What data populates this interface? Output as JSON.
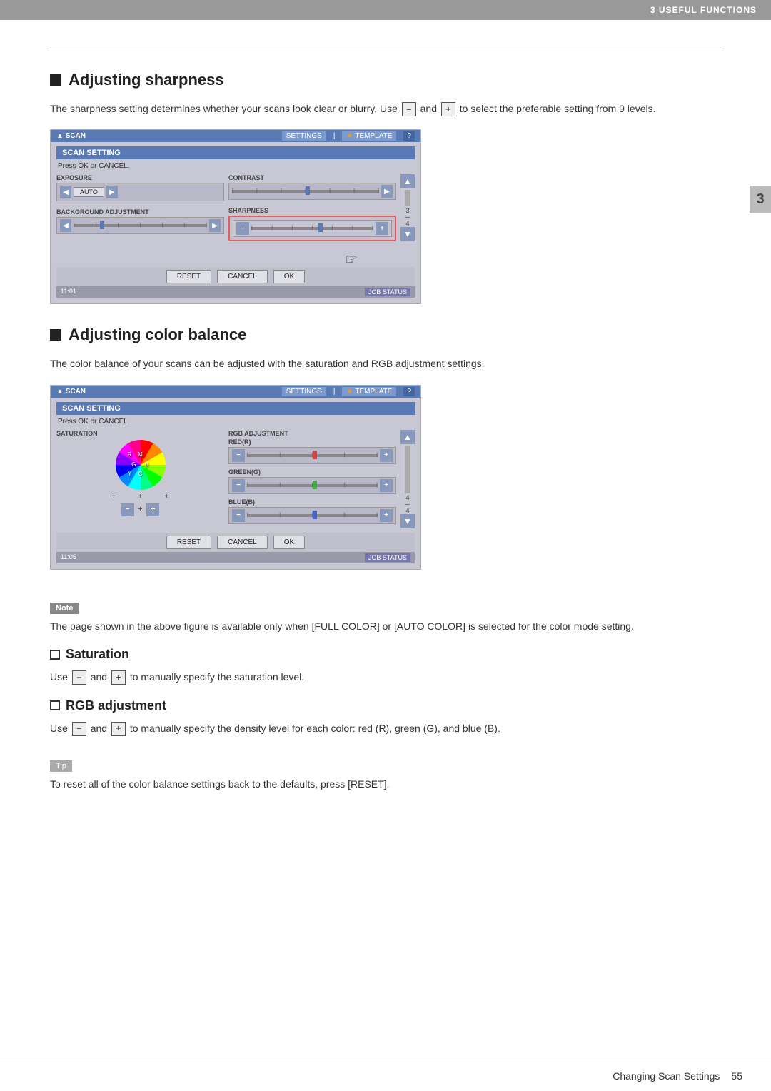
{
  "topBar": {
    "text": "3 USEFUL FUNCTIONS"
  },
  "sideTab": {
    "number": "3"
  },
  "sections": {
    "sharpness": {
      "heading": "Adjusting sharpness",
      "bodyText": "The sharpness setting determines whether your scans look clear or blurry. Use",
      "bodyText2": "and",
      "bodyText3": "to select the preferable setting from 9 levels.",
      "screen": {
        "titleText": "SCAN",
        "settingsLabel": "SETTINGS",
        "templateLabel": "TEMPLATE",
        "questionMark": "?",
        "headerLabel": "SCAN SETTING",
        "subtext": "Press OK or CANCEL.",
        "exposureLabel": "EXPOSURE",
        "contrastLabel": "CONTRAST",
        "bgAdjLabel": "BACKGROUND ADJUSTMENT",
        "sharpnessLabel": "SHARPNESS",
        "resetBtn": "RESET",
        "cancelBtn": "CANCEL",
        "okBtn": "OK",
        "time": "11:01",
        "jobStatus": "JOB STATUS"
      }
    },
    "colorBalance": {
      "heading": "Adjusting color balance",
      "bodyText": "The color balance of your scans can be adjusted with the saturation and RGB adjustment settings.",
      "screen": {
        "titleText": "SCAN",
        "settingsLabel": "SETTINGS",
        "templateLabel": "TEMPLATE",
        "questionMark": "?",
        "headerLabel": "SCAN SETTING",
        "subtext": "Press OK or CANCEL.",
        "saturationLabel": "SATURATION",
        "rgbAdjLabel": "RGB ADJUSTMENT",
        "redLabel": "RED(R)",
        "greenLabel": "GREEN(G)",
        "blueLabel": "BLUE(B)",
        "resetBtn": "RESET",
        "cancelBtn": "CANCEL",
        "okBtn": "OK",
        "time": "11:05",
        "jobStatus": "JOB STATUS",
        "colorWheelLabels": {
          "c": "C",
          "y": "Y",
          "g": "G",
          "r": "R",
          "m": "M",
          "b": "B"
        }
      },
      "noteLabel": "Note",
      "noteText": "The page shown in the above figure is available only when [FULL COLOR] or [AUTO COLOR] is selected for the color mode setting."
    },
    "saturation": {
      "heading": "Saturation",
      "bodyText": "Use",
      "bodyText2": "and",
      "bodyText3": "to manually specify the saturation level."
    },
    "rgbAdjustment": {
      "heading": "RGB adjustment",
      "bodyText": "Use",
      "bodyText2": "and",
      "bodyText3": "to manually specify the density level for each color: red (R), green (G), and blue (B).",
      "tipLabel": "Tip",
      "tipText": "To reset all of the color balance settings back to the defaults, press [RESET]."
    }
  },
  "bottomBar": {
    "pageLabel": "Changing Scan Settings",
    "pageNum": "55"
  },
  "buttons": {
    "minus": "−",
    "plus": "+"
  }
}
